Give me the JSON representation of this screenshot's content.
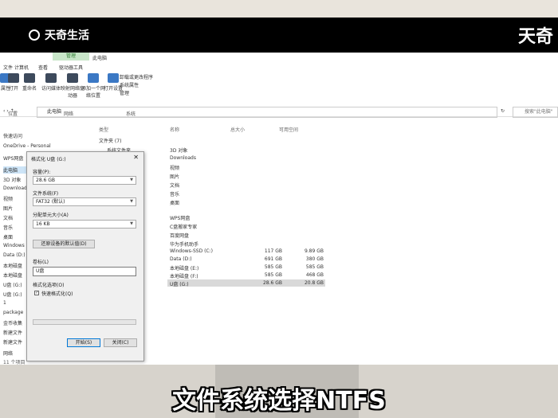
{
  "brand": {
    "logo_text": "天奇生活",
    "corner_text": "天奇"
  },
  "caption": "文件系统选择NTFS",
  "ribbon_tabs": {
    "file": "文件",
    "computer": "计算机",
    "view": "查看",
    "drive_tools": "驱动器工具",
    "manage": "管理",
    "title": "此电脑"
  },
  "ribbon": {
    "properties": "属性",
    "open": "打开",
    "rename": "重命名",
    "access_media": "访问媒体",
    "map_drive": "映射网络驱动器",
    "add_location": "添加一个网络位置",
    "open_settings": "打开设置",
    "uninstall": "卸载或更改程序",
    "system_props": "系统属性",
    "manage": "管理",
    "group_location": "位置",
    "group_network": "网络",
    "group_system": "系统"
  },
  "address": {
    "path": "此电脑",
    "search_placeholder": "搜索\"此电脑\""
  },
  "columns": {
    "type": "类型",
    "name": "名称",
    "total": "总大小",
    "free": "可用空间"
  },
  "folder_group": "文件夹 (7)",
  "folder_group_first": "系统文件夹",
  "sidebar": {
    "quick_access": "快速访问",
    "onedrive": "OneDrive - Personal",
    "wps": "WPS网盘",
    "this_pc": "此电脑",
    "objects3d": "3D 对象",
    "downloads": "Downloads",
    "videos": "视频",
    "pictures": "图片",
    "docs": "文档",
    "music": "音乐",
    "desktop": "桌面",
    "windows": "Windows",
    "data_d": "Data (D:)",
    "local1": "本地磁盘",
    "local2": "本地磁盘",
    "udisk": "U盘 (G:)",
    "udisk2": "U盘 (G:)",
    "item_1": "1",
    "package": "package",
    "coin": "金币收集",
    "newfolder": "新建文件",
    "newfolder2": "新建文件",
    "network": "网络",
    "items_count": "11 个项目"
  },
  "folders": [
    "3D 对象",
    "Downloads",
    "视频",
    "图片",
    "文档",
    "音乐",
    "桌面"
  ],
  "net_items": [
    "WPS网盘",
    "C盘搬家专家",
    "百度网盘",
    "华为手机助手"
  ],
  "drives": [
    {
      "name": "Windows-SSD (C:)",
      "total": "117 GB",
      "free": "9.89 GB"
    },
    {
      "name": "Data (D:)",
      "total": "691 GB",
      "free": "380 GB"
    },
    {
      "name": "本地磁盘 (E:)",
      "total": "585 GB",
      "free": "585 GB"
    },
    {
      "name": "本地磁盘 (F:)",
      "total": "585 GB",
      "free": "468 GB"
    },
    {
      "name": "U盘 (G:)",
      "total": "28.6 GB",
      "free": "20.8 GB"
    }
  ],
  "dialog": {
    "title": "格式化 U盘 (G:)",
    "capacity_label": "容量(P):",
    "capacity_value": "28.6 GB",
    "fs_label": "文件系统(F)",
    "fs_value": "FAT32 (默认)",
    "alloc_label": "分配单元大小(A)",
    "alloc_value": "16 KB",
    "restore_btn": "还原设备的默认值(D)",
    "vol_label": "卷标(L)",
    "vol_value": "U盘",
    "options_label": "格式化选项(O)",
    "quick_format": "快速格式化(Q)",
    "start_btn": "开始(S)",
    "close_btn": "关闭(C)"
  }
}
